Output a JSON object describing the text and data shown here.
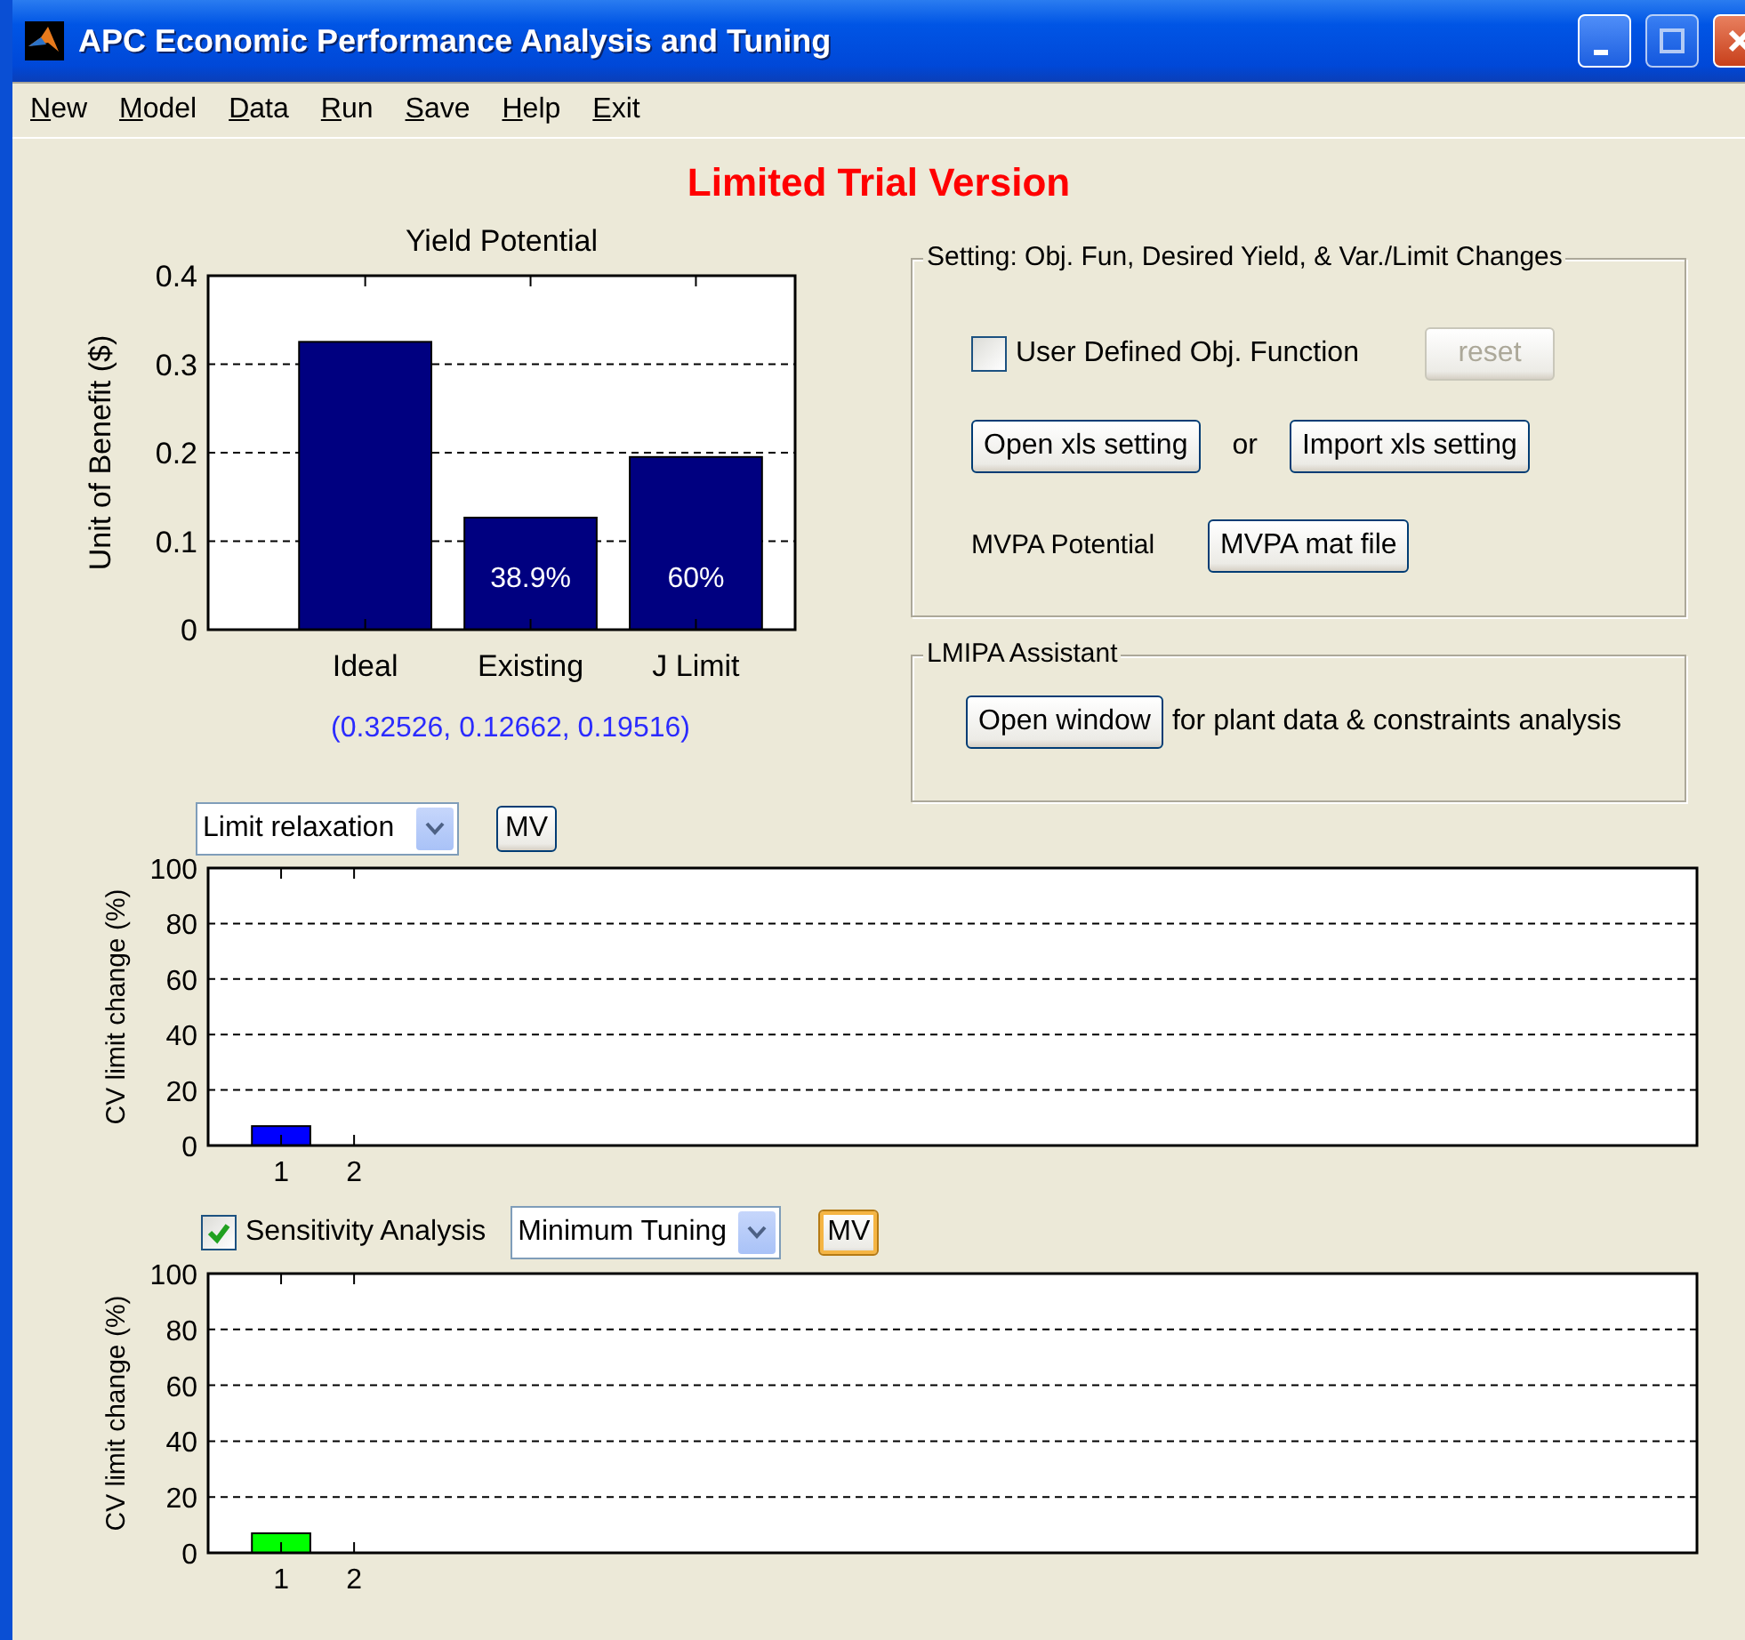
{
  "window": {
    "title": "APC Economic Performance Analysis and Tuning"
  },
  "menu": [
    {
      "label": "New"
    },
    {
      "label": "Model"
    },
    {
      "label": "Data"
    },
    {
      "label": "Run"
    },
    {
      "label": "Save"
    },
    {
      "label": "Help"
    },
    {
      "label": "Exit"
    }
  ],
  "banner": "Limited Trial Version",
  "yield_panel": {
    "chart_data": {
      "type": "bar",
      "title": "Yield Potential",
      "ylabel": "Unit of Benefit ($)",
      "categories": [
        "Ideal",
        "Existing",
        "J Limit"
      ],
      "series": [
        {
          "color": "#000080",
          "values": [
            0.32526,
            0.12662,
            0.19516
          ]
        }
      ],
      "ylim": [
        0,
        0.4
      ],
      "yticks": [
        0,
        0.1,
        0.2,
        0.3,
        0.4
      ],
      "grid": true,
      "value_labels": [
        null,
        "38.9%",
        "60%"
      ]
    },
    "caption": "(0.32526, 0.12662, 0.19516)"
  },
  "settings_group": {
    "legend": "Setting: Obj. Fun, Desired Yield, & Var./Limit Changes",
    "user_defined_checkbox": {
      "label": "User Defined Obj. Function",
      "checked": false
    },
    "reset_button": {
      "label": "reset",
      "disabled": true
    },
    "open_button": "Open xls setting",
    "or_text": "or",
    "import_button": "Import xls setting",
    "mvpa_label": "MVPA Potential",
    "mvpa_button": "MVPA mat file"
  },
  "lmipa_group": {
    "legend": "LMIPA Assistant",
    "open_button": "Open window",
    "description": "for plant data & constraints analysis"
  },
  "limit_panel": {
    "dropdown": "Limit relaxation",
    "mv_button": {
      "label": "MV",
      "focused": false
    },
    "chart_data": {
      "type": "bar",
      "ylabel": "CV limit change (%)",
      "x": [
        1,
        2
      ],
      "series": [
        {
          "color": "#0000ff",
          "values": [
            7,
            0
          ]
        }
      ],
      "grid": true,
      "xlim": [
        0,
        20.4
      ],
      "ylim": [
        0,
        100
      ],
      "xticks": [
        1,
        2
      ],
      "yticks": [
        0,
        20,
        40,
        60,
        80,
        100
      ]
    }
  },
  "sensitivity_panel": {
    "checkbox": {
      "label": "Sensitivity Analysis",
      "checked": true
    },
    "dropdown": "Minimum Tuning",
    "mv_button": {
      "label": "MV",
      "focused": true
    },
    "chart_data": {
      "type": "bar",
      "ylabel": "CV limit change (%)",
      "x": [
        1,
        2
      ],
      "series": [
        {
          "color": "#00ff00",
          "values": [
            7,
            0
          ]
        }
      ],
      "grid": true,
      "xlim": [
        0,
        20.4
      ],
      "ylim": [
        0,
        100
      ],
      "xticks": [
        1,
        2
      ],
      "yticks": [
        0,
        20,
        40,
        60,
        80,
        100
      ]
    }
  }
}
